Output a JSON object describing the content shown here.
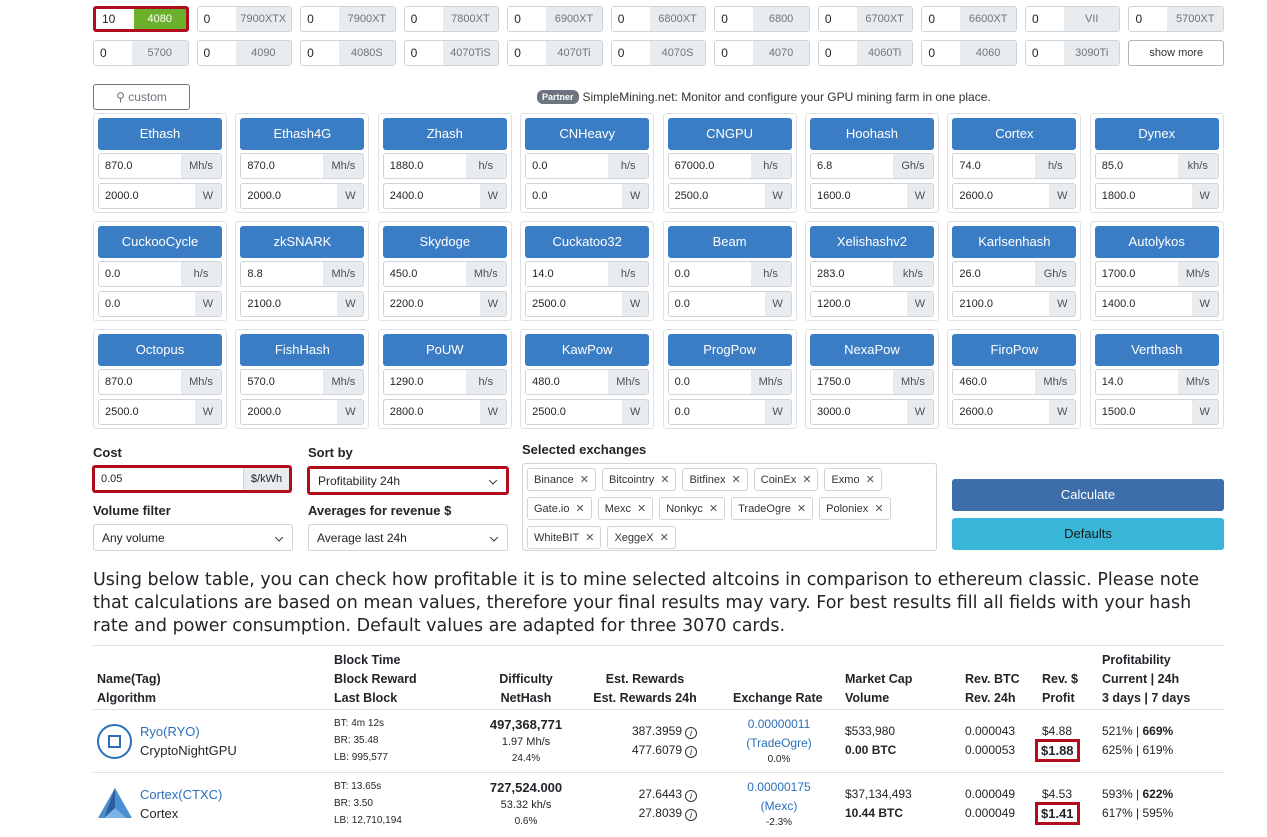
{
  "gpus": {
    "row1": [
      {
        "qty": "10",
        "name": "4080",
        "active": true
      },
      {
        "qty": "0",
        "name": "7900XTX"
      },
      {
        "qty": "0",
        "name": "7900XT"
      },
      {
        "qty": "0",
        "name": "7800XT"
      },
      {
        "qty": "0",
        "name": "6900XT"
      },
      {
        "qty": "0",
        "name": "6800XT"
      },
      {
        "qty": "0",
        "name": "6800"
      },
      {
        "qty": "0",
        "name": "6700XT"
      },
      {
        "qty": "0",
        "name": "6600XT"
      },
      {
        "qty": "0",
        "name": "VII"
      },
      {
        "qty": "0",
        "name": "5700XT"
      }
    ],
    "row2": [
      {
        "qty": "0",
        "name": "5700"
      },
      {
        "qty": "0",
        "name": "4090"
      },
      {
        "qty": "0",
        "name": "4080S"
      },
      {
        "qty": "0",
        "name": "4070TiS"
      },
      {
        "qty": "0",
        "name": "4070Ti"
      },
      {
        "qty": "0",
        "name": "4070S"
      },
      {
        "qty": "0",
        "name": "4070"
      },
      {
        "qty": "0",
        "name": "4060Ti"
      },
      {
        "qty": "0",
        "name": "4060"
      },
      {
        "qty": "0",
        "name": "3090Ti"
      }
    ],
    "show_more": "show more"
  },
  "custom_label": "custom",
  "partner": {
    "badge": "Partner",
    "text": "SimpleMining.net: Monitor and configure your GPU mining farm in one place."
  },
  "algorithms": [
    {
      "name": "Ethash",
      "hash": "870.0",
      "unit": "Mh/s",
      "power": "2000.0"
    },
    {
      "name": "Ethash4G",
      "hash": "870.0",
      "unit": "Mh/s",
      "power": "2000.0"
    },
    {
      "name": "Zhash",
      "hash": "1880.0",
      "unit": "h/s",
      "power": "2400.0"
    },
    {
      "name": "CNHeavy",
      "hash": "0.0",
      "unit": "h/s",
      "power": "0.0"
    },
    {
      "name": "CNGPU",
      "hash": "67000.0",
      "unit": "h/s",
      "power": "2500.0"
    },
    {
      "name": "Hoohash",
      "hash": "6.8",
      "unit": "Gh/s",
      "power": "1600.0"
    },
    {
      "name": "Cortex",
      "hash": "74.0",
      "unit": "h/s",
      "power": "2600.0"
    },
    {
      "name": "Dynex",
      "hash": "85.0",
      "unit": "kh/s",
      "power": "1800.0"
    },
    {
      "name": "CuckooCycle",
      "hash": "0.0",
      "unit": "h/s",
      "power": "0.0"
    },
    {
      "name": "zkSNARK",
      "hash": "8.8",
      "unit": "Mh/s",
      "power": "2100.0"
    },
    {
      "name": "Skydoge",
      "hash": "450.0",
      "unit": "Mh/s",
      "power": "2200.0"
    },
    {
      "name": "Cuckatoo32",
      "hash": "14.0",
      "unit": "h/s",
      "power": "2500.0"
    },
    {
      "name": "Beam",
      "hash": "0.0",
      "unit": "h/s",
      "power": "0.0"
    },
    {
      "name": "Xelishashv2",
      "hash": "283.0",
      "unit": "kh/s",
      "power": "1200.0"
    },
    {
      "name": "Karlsenhash",
      "hash": "26.0",
      "unit": "Gh/s",
      "power": "2100.0"
    },
    {
      "name": "Autolykos",
      "hash": "1700.0",
      "unit": "Mh/s",
      "power": "1400.0"
    },
    {
      "name": "Octopus",
      "hash": "870.0",
      "unit": "Mh/s",
      "power": "2500.0"
    },
    {
      "name": "FishHash",
      "hash": "570.0",
      "unit": "Mh/s",
      "power": "2000.0"
    },
    {
      "name": "PoUW",
      "hash": "1290.0",
      "unit": "h/s",
      "power": "2800.0"
    },
    {
      "name": "KawPow",
      "hash": "480.0",
      "unit": "Mh/s",
      "power": "2500.0"
    },
    {
      "name": "ProgPow",
      "hash": "0.0",
      "unit": "Mh/s",
      "power": "0.0"
    },
    {
      "name": "NexaPow",
      "hash": "1750.0",
      "unit": "Mh/s",
      "power": "3000.0"
    },
    {
      "name": "FiroPow",
      "hash": "460.0",
      "unit": "Mh/s",
      "power": "2600.0"
    },
    {
      "name": "Verthash",
      "hash": "14.0",
      "unit": "Mh/s",
      "power": "1500.0"
    }
  ],
  "power_unit": "W",
  "cost": {
    "label": "Cost",
    "value": "0.05",
    "unit": "$/kWh"
  },
  "sort_by": {
    "label": "Sort by",
    "value": "Profitability 24h"
  },
  "volume_filter": {
    "label": "Volume filter",
    "value": "Any volume"
  },
  "averages": {
    "label": "Averages for revenue $",
    "value": "Average last 24h"
  },
  "exchanges": {
    "label": "Selected exchanges",
    "items": [
      "Binance",
      "Bitcointry",
      "Bitfinex",
      "CoinEx",
      "Exmo",
      "Gate.io",
      "Mexc",
      "Nonkyc",
      "TradeOgre",
      "Poloniex",
      "WhiteBIT",
      "XeggeX"
    ]
  },
  "buttons": {
    "calculate": "Calculate",
    "defaults": "Defaults"
  },
  "intro": "Using below table, you can check how profitable it is to mine selected altcoins in comparison to ethereum classic. Please note that calculations are based on mean values, therefore your final results may vary. For best results fill all fields with your hash rate and power consumption. Default values are adapted for three 3070 cards.",
  "table": {
    "headers": {
      "name1": "Name(Tag)",
      "name2": "Algorithm",
      "bt1": "Block Time",
      "bt2": "Block Reward",
      "bt3": "Last Block",
      "diff1": "Difficulty",
      "diff2": "NetHash",
      "est1": "Est. Rewards",
      "est2": "Est. Rewards 24h",
      "rate": "Exchange Rate",
      "mc1": "Market Cap",
      "mc2": "Volume",
      "rbtc1": "Rev. BTC",
      "rbtc2": "Rev. 24h",
      "rusd1": "Rev. $",
      "rusd2": "Profit",
      "prof1": "Profitability",
      "prof2": "Current | 24h",
      "prof3": "3 days | 7 days"
    },
    "rows": [
      {
        "name": "Ryo(RYO)",
        "algo": "CryptoNightGPU",
        "bt": "BT: 4m 12s",
        "br": "BR: 35.48",
        "lb": "LB: 995,577",
        "difficulty": "497,368,771",
        "nethash": "1.97 Mh/s",
        "diff_pct": "24.4%",
        "est": "387.3959",
        "est24": "477.6079",
        "rate": "0.00000011",
        "exchange": "(TradeOgre)",
        "rate_pct": "0.0%",
        "mcap": "$533,980",
        "volume": "0.00 BTC",
        "rev_btc": "0.000043",
        "rev_btc24": "0.000053",
        "rev_usd": "$4.88",
        "profit": "$1.88",
        "prof_cur": "521%",
        "prof_24": "669%",
        "prof_3d": "625%",
        "prof_7d": "619%"
      },
      {
        "name": "Cortex(CTXC)",
        "algo": "Cortex",
        "bt": "BT: 13.65s",
        "br": "BR: 3.50",
        "lb": "LB: 12,710,194",
        "difficulty": "727,524.000",
        "nethash": "53.32 kh/s",
        "diff_pct": "0.6%",
        "est": "27.6443",
        "est24": "27.8039",
        "rate": "0.00000175",
        "exchange": "(Mexc)",
        "rate_pct": "-2.3%",
        "mcap": "$37,134,493",
        "volume": "10.44 BTC",
        "rev_btc": "0.000049",
        "rev_btc24": "0.000049",
        "rev_usd": "$4.53",
        "profit": "$1.41",
        "prof_cur": "593%",
        "prof_24": "622%",
        "prof_3d": "617%",
        "prof_7d": "595%"
      }
    ]
  }
}
